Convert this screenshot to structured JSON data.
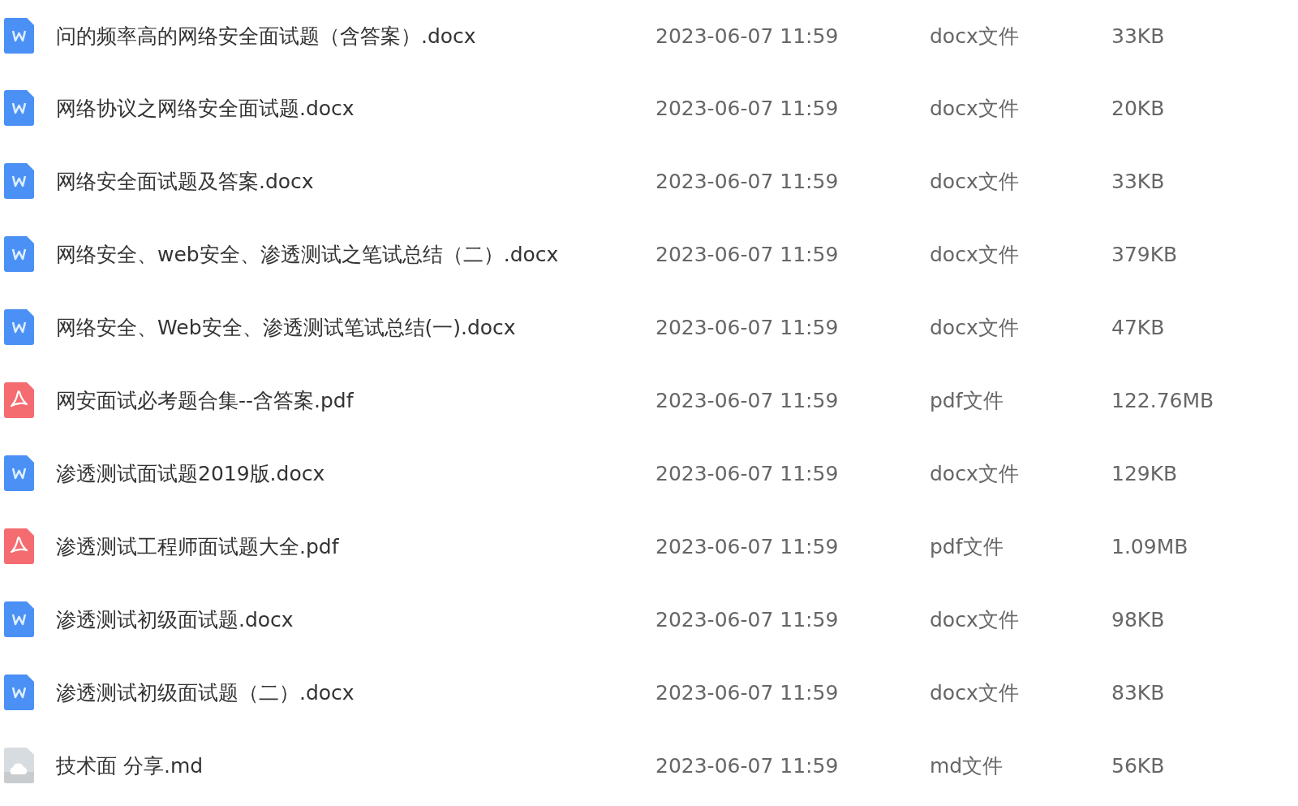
{
  "files": [
    {
      "kind": "word",
      "name": "问的频率高的网络安全面试题（含答案）.docx",
      "modified": "2023-06-07 11:59",
      "type": "docx文件",
      "size": "33KB"
    },
    {
      "kind": "word",
      "name": "网络协议之网络安全面试题.docx",
      "modified": "2023-06-07 11:59",
      "type": "docx文件",
      "size": "20KB"
    },
    {
      "kind": "word",
      "name": "网络安全面试题及答案.docx",
      "modified": "2023-06-07 11:59",
      "type": "docx文件",
      "size": "33KB"
    },
    {
      "kind": "word",
      "name": "网络安全、web安全、渗透测试之笔试总结（二）.docx",
      "modified": "2023-06-07 11:59",
      "type": "docx文件",
      "size": "379KB"
    },
    {
      "kind": "word",
      "name": "网络安全、Web安全、渗透测试笔试总结(一).docx",
      "modified": "2023-06-07 11:59",
      "type": "docx文件",
      "size": "47KB"
    },
    {
      "kind": "pdf",
      "name": "网安面试必考题合集--含答案.pdf",
      "modified": "2023-06-07 11:59",
      "type": "pdf文件",
      "size": "122.76MB"
    },
    {
      "kind": "word",
      "name": "渗透测试面试题2019版.docx",
      "modified": "2023-06-07 11:59",
      "type": "docx文件",
      "size": "129KB"
    },
    {
      "kind": "pdf",
      "name": "渗透测试工程师面试题大全.pdf",
      "modified": "2023-06-07 11:59",
      "type": "pdf文件",
      "size": "1.09MB"
    },
    {
      "kind": "word",
      "name": "渗透测试初级面试题.docx",
      "modified": "2023-06-07 11:59",
      "type": "docx文件",
      "size": "98KB"
    },
    {
      "kind": "word",
      "name": "渗透测试初级面试题（二）.docx",
      "modified": "2023-06-07 11:59",
      "type": "docx文件",
      "size": "83KB"
    },
    {
      "kind": "file",
      "name": "技术面 分享.md",
      "modified": "2023-06-07 11:59",
      "type": "md文件",
      "size": "56KB"
    }
  ]
}
